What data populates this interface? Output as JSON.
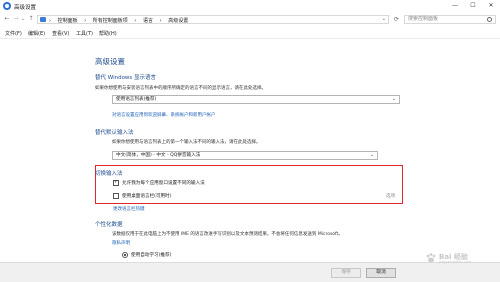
{
  "window": {
    "title": "高级设置",
    "controls": {
      "minimize": "—",
      "maximize": "☐",
      "close": "✕"
    }
  },
  "address": {
    "nav": {
      "back": "←",
      "forward": "→",
      "dropdown": "⌄",
      "up": "↑"
    },
    "crumbs": [
      "›",
      "控制面板",
      "›",
      "所有控制面板项",
      "›",
      "语言",
      "›",
      "高级设置"
    ],
    "crumb_dropdown": "⌄",
    "refresh": "⟳",
    "search_placeholder": "搜索控制面板"
  },
  "menu": [
    "文件(F)",
    "编辑(E)",
    "查看(V)",
    "工具(T)",
    "帮助(H)"
  ],
  "page": {
    "title": "高级设置",
    "display_language": {
      "heading": "替代 Windows 显示语言",
      "desc": "如果你想使用与安装语言列表中的顺序所确定的语言不同的显示语言，请在此处选择。",
      "selected": "使用语言列表(推荐)",
      "link1": "对语言设置应用到欢迎屏幕、系统帐户和新用户帐户"
    },
    "input_method": {
      "heading": "替代默认输入法",
      "desc": "如果你想使用与语言列表上的第一个输入法不同的输入法，请在此处选择。",
      "selected": "中文(简体，中国) - 中文 - QQ拼音输入法"
    },
    "switch": {
      "heading": "切换输入法",
      "opt1": "允许我为每个应用窗口设置不同的输入法",
      "opt2": "使用桌面语言栏(可用时)",
      "opt2_tag": "选项",
      "link": "更改语言栏热键"
    },
    "personalization": {
      "heading": "个性化数据",
      "desc": "该数据仅用于在此电脑上为不使用 IME 的语言改进手写识别以及文本预测结果。不会将任何信息发送到 Microsoft。",
      "privacy_link": "隐私声明",
      "radio1": "使用自动学习(推荐)"
    }
  },
  "footer": {
    "save": "保存",
    "cancel": "取消"
  },
  "watermark": {
    "text": "Bai 经验",
    "sub": "jingyan.baidu.com"
  },
  "colors": {
    "heading": "#1e4b8f",
    "link": "#1a5fb4",
    "highlight": "#e0262f"
  }
}
